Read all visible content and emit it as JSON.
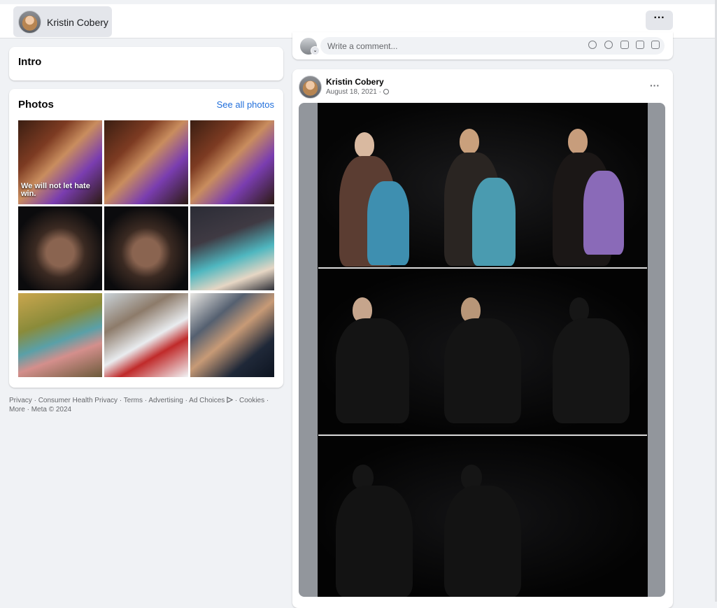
{
  "header": {
    "profile_name": "Kristin Cobery",
    "more_icon": "more-horizontal-icon",
    "more_label": "···"
  },
  "intro": {
    "title": "Intro"
  },
  "photos": {
    "title": "Photos",
    "see_all": "See all photos",
    "first_photo_caption": "We will not let hate win."
  },
  "footer": {
    "links": [
      "Privacy",
      "Consumer Health Privacy",
      "Terms",
      "Advertising",
      "Ad Choices",
      "Cookies",
      "More"
    ],
    "copyright": "Meta © 2024",
    "separator": " · "
  },
  "comment_box": {
    "placeholder": "Write a comment...",
    "chevron": "⌄",
    "icons": [
      "avatar-sticker-icon",
      "emoji-icon",
      "camera-icon",
      "gif-icon",
      "sticker-icon"
    ]
  },
  "post": {
    "author": "Kristin Cobery",
    "date": "August 18, 2021",
    "date_separator": " · ",
    "privacy_icon": "globe-icon",
    "more_label": "···"
  },
  "colors": {
    "page_bg": "#f0f2f5",
    "link_blue": "#216fdb",
    "card_bg": "#ffffff",
    "secondary_text": "#65676b"
  }
}
